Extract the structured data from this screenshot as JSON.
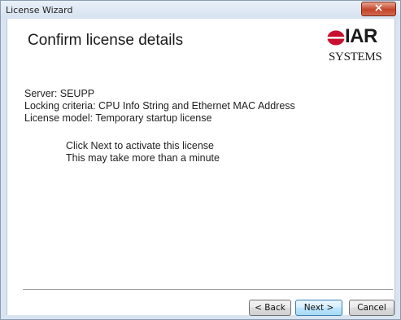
{
  "window": {
    "title": "License Wizard"
  },
  "header": {
    "title": "Confirm license details",
    "logo": {
      "brand": "IAR",
      "subtitle": "SYSTEMS",
      "mark_color": "#c8102e"
    }
  },
  "details": {
    "server": "Server: SEUPP",
    "locking_criteria": "Locking criteria: CPU Info String and Ethernet MAC Address",
    "license_model": "License model: Temporary startup license"
  },
  "notice": {
    "line1": "Click Next to activate this license",
    "line2": "This may take more than a minute"
  },
  "buttons": {
    "back": "< Back",
    "next": "Next >",
    "cancel": "Cancel"
  },
  "colors": {
    "close_button": "#c4442a",
    "default_button_border": "#3c7fb1"
  }
}
